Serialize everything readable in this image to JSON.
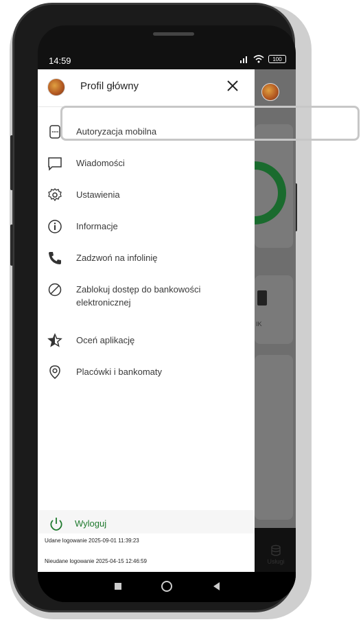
{
  "status_bar": {
    "time": "14:59",
    "battery": "100"
  },
  "drawer": {
    "title": "Profil główny",
    "close_icon": "close-icon",
    "items": [
      {
        "label": "Autoryzacja mobilna",
        "icon": "mobile-authorization-icon"
      },
      {
        "label": "Wiadomości",
        "icon": "message-icon"
      },
      {
        "label": "Ustawienia",
        "icon": "gear-icon"
      },
      {
        "label": "Informacje",
        "icon": "info-icon"
      },
      {
        "label": "Zadzwoń na infolinię",
        "icon": "phone-icon"
      },
      {
        "label": "Zablokuj dostęp do bankowości elektronicznej",
        "icon": "block-icon"
      },
      {
        "label": "Oceń aplikację",
        "icon": "star-icon"
      },
      {
        "label": "Placówki i bankomaty",
        "icon": "location-icon"
      }
    ],
    "logout_label": "Wyloguj",
    "login_success": "Udane logowanie 2025-09-01 11:39:23",
    "login_failed": "Nieudane logowanie 2025-04-15 12:46:59"
  },
  "background_app": {
    "blik_partial": "IK",
    "services_label": "Usługi"
  },
  "colors": {
    "accent_green": "#1f7a2e",
    "drawer_bg": "#ffffff",
    "overlay": "#6e6e6e"
  }
}
